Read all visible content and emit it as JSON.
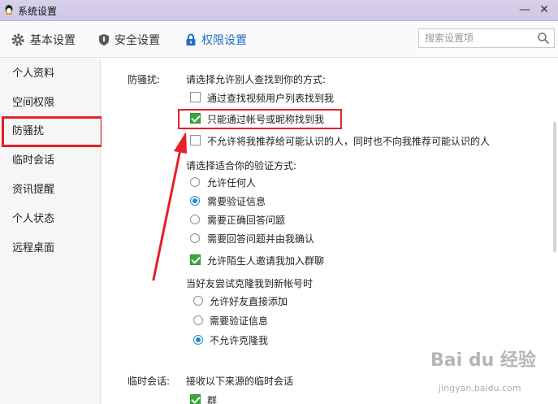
{
  "window": {
    "title": "系统设置",
    "minimize": "—",
    "close": "✕"
  },
  "tabs": [
    {
      "label": "基本设置",
      "icon": "gear-icon"
    },
    {
      "label": "安全设置",
      "icon": "shield-icon"
    },
    {
      "label": "权限设置",
      "icon": "lock-icon",
      "active": true
    }
  ],
  "search": {
    "placeholder": "搜索设置项",
    "value": ""
  },
  "sidebar": {
    "items": [
      {
        "label": "个人资料"
      },
      {
        "label": "空间权限"
      },
      {
        "label": "防骚扰",
        "selected": true
      },
      {
        "label": "临时会话"
      },
      {
        "label": "资讯提醒"
      },
      {
        "label": "个人状态"
      },
      {
        "label": "远程桌面"
      }
    ]
  },
  "sections": {
    "anti_harass": {
      "title": "防骚扰:",
      "find_prompt": "请选择允许别人查找到你的方式:",
      "find_options": [
        {
          "label": "通过查找视频用户列表找到我",
          "checked": false
        },
        {
          "label": "只能通过帐号或昵称找到我",
          "checked": true
        },
        {
          "label": "不允许将我推荐给可能认识的人，同时也不向我推荐可能认识的人",
          "checked": false
        }
      ],
      "verify_prompt": "请选择适合你的验证方式:",
      "verify_options": [
        {
          "label": "允许任何人",
          "selected": false
        },
        {
          "label": "需要验证信息",
          "selected": true
        },
        {
          "label": "需要正确回答问题",
          "selected": false
        },
        {
          "label": "需要回答问题并由我确认",
          "selected": false
        }
      ],
      "group_invite": {
        "label": "允许陌生人邀请我加入群聊",
        "checked": true
      },
      "clone_prompt": "当好友尝试克隆我到新帐号时",
      "clone_options": [
        {
          "label": "允许好友直接添加",
          "selected": false
        },
        {
          "label": "需要验证信息",
          "selected": false
        },
        {
          "label": "不允许克隆我",
          "selected": true
        }
      ]
    },
    "temp_session": {
      "title": "临时会话:",
      "prompt": "接收以下来源的临时会话",
      "options": [
        {
          "label": "群",
          "checked": true
        }
      ]
    }
  },
  "watermark": {
    "brand": "Bai du 经验",
    "url": "jingyan.baidu.com"
  },
  "colors": {
    "highlight_red": "#e3202b",
    "accent_blue": "#1f6fc8",
    "check_green": "#3aa640"
  }
}
